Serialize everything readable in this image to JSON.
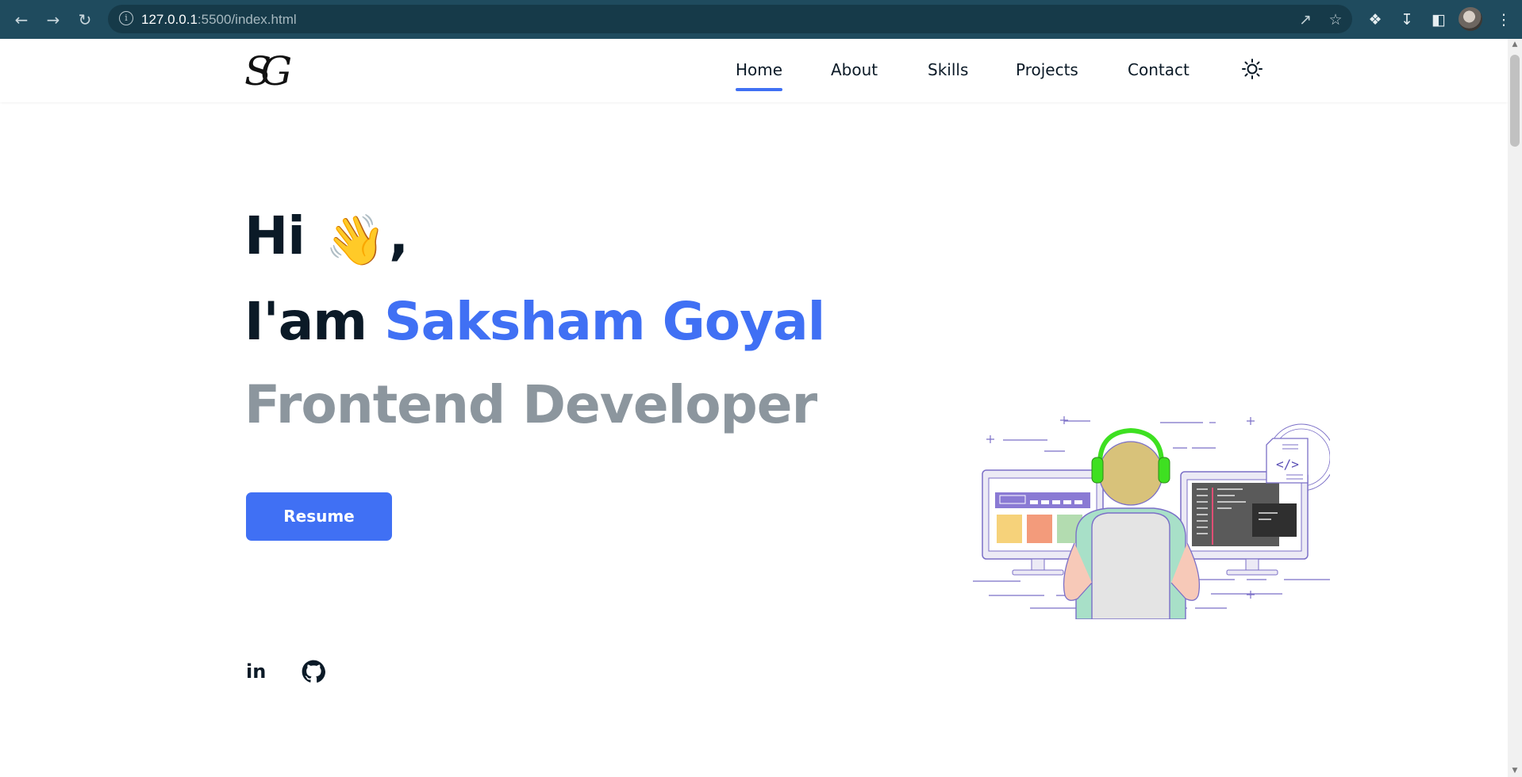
{
  "browser": {
    "url_host": "127.0.0.1",
    "url_rest": ":5500/index.html",
    "back_icon": "arrow-left-icon",
    "forward_icon": "arrow-right-icon",
    "reload_icon": "reload-icon"
  },
  "header": {
    "logo": "SG",
    "nav": [
      {
        "label": "Home",
        "active": true
      },
      {
        "label": "About"
      },
      {
        "label": "Skills"
      },
      {
        "label": "Projects"
      },
      {
        "label": "Contact"
      }
    ],
    "theme_toggle_icon": "sun-icon"
  },
  "hero": {
    "greeting": "Hi",
    "wave_emoji": "👋",
    "comma": ",",
    "intro_prefix": "I'am",
    "name": "Saksham Goyal",
    "role": "Frontend Developer",
    "resume_button": "Resume",
    "socials": [
      {
        "icon": "linkedin-icon",
        "label": "in"
      },
      {
        "icon": "github-icon"
      }
    ]
  },
  "colors": {
    "accent": "#4070f4",
    "text_dark": "#0b1a27",
    "text_muted": "#8c969e",
    "browser_bar": "#1f4b5e"
  }
}
